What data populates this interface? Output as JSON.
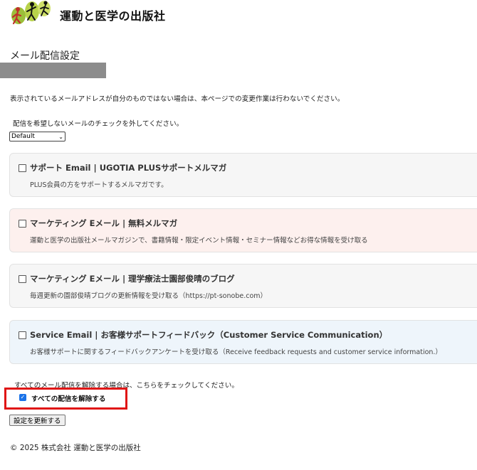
{
  "header": {
    "brand": "運動と医学の出版社"
  },
  "page": {
    "title": "メール配信設定",
    "notice": "表示されているメールアドレスが自分のものではない場合は、本ページでの変更作業は行わないでください。",
    "instruction": "配信を希望しないメールのチェックを外してください。",
    "language_select": "Default"
  },
  "subscriptions": [
    {
      "title": "サポート Email | UGOTIA PLUSサポートメルマガ",
      "description": "PLUS会員の方をサポートするメルマガです。",
      "checked": false,
      "bg": "#f6f6f6"
    },
    {
      "title": "マーケティング Eメール | 無料メルマガ",
      "description": "運動と医学の出版社メールマガジンで、書籍情報・限定イベント情報・セミナー情報などお得な情報を受け取る",
      "checked": false,
      "bg": "#fdf0ee"
    },
    {
      "title": "マーケティング Eメール | 理学療法士園部俊晴のブログ",
      "description": "毎週更新の園部俊晴ブログの更新情報を受け取る（https://pt-sonobe.com）",
      "checked": false,
      "bg": "#f6f6f6"
    },
    {
      "title": "Service Email | お客様サポートフィードバック（Customer Service Communication）",
      "description": "お客様サポートに関するフィードバックアンケートを受け取る（Receive feedback requests and customer service information.）",
      "checked": false,
      "bg": "#eef5fb"
    }
  ],
  "unsubscribe": {
    "note": "すべてのメール配信を解除する場合は、こちらをチェックしてください。",
    "label": "すべての配信を解除する",
    "checked": true
  },
  "update_button": "設定を更新する",
  "footer": "© 2025 株式会社 運動と医学の出版社",
  "colors": {
    "highlight_border": "#e01515",
    "checkbox_checked": "#1a73e8"
  }
}
